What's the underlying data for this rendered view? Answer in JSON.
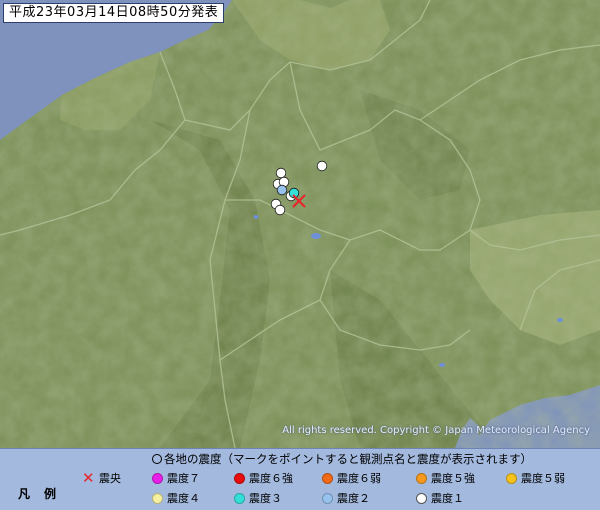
{
  "map": {
    "announcement": "平成23年03月14日08時50分発表",
    "copyright": "All rights reserved. Copyright © Japan Meteorological Agency",
    "epicenter": {
      "icon": "cross-mark-icon",
      "color": "#e8242a"
    },
    "stations": [
      {
        "intensity": "震度1"
      },
      {
        "intensity": "震度1"
      },
      {
        "intensity": "震度1"
      },
      {
        "intensity": "震度1"
      },
      {
        "intensity": "震度1"
      },
      {
        "intensity": "震度1"
      },
      {
        "intensity": "震度1"
      },
      {
        "intensity": "震度2"
      },
      {
        "intensity": "震度3"
      }
    ],
    "colors": {
      "land": "#7b8f57",
      "mountain": "#6a7d48",
      "lowland": "#97a66d",
      "sea": "#7e92bd",
      "border": "#aebc8f",
      "lake": "#6f8fd8"
    }
  },
  "legend": {
    "header": "各地の震度（マークをポイントすると観測点名と震度が表示されます）",
    "title": "凡例",
    "epicenter_label": "震央",
    "items": [
      {
        "label": "震度７",
        "color": "#e81fe8"
      },
      {
        "label": "震度６強",
        "color": "#e80c0c"
      },
      {
        "label": "震度６弱",
        "color": "#f26a18"
      },
      {
        "label": "震度５強",
        "color": "#f59a1f"
      },
      {
        "label": "震度５弱",
        "color": "#f5c21a"
      },
      {
        "label": "震度４",
        "color": "#f4f0a0"
      },
      {
        "label": "震度３",
        "color": "#33e0d8"
      },
      {
        "label": "震度２",
        "color": "#97c2ee"
      },
      {
        "label": "震度１",
        "color": "#ffffff"
      }
    ]
  }
}
